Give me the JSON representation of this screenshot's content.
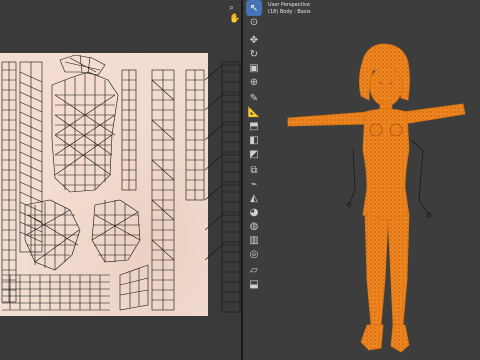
{
  "uv_editor": {
    "header_icons": [
      {
        "name": "search-icon",
        "glyph": "🔍"
      },
      {
        "name": "hand-icon",
        "glyph": "✋"
      }
    ]
  },
  "viewport": {
    "view_name": "User Perspective",
    "object_info": "(18) Body : Basis"
  },
  "toolbar": {
    "tools": [
      {
        "name": "select-tool",
        "glyph": "↖",
        "active": true
      },
      {
        "name": "cursor-tool",
        "glyph": "⊙",
        "active": false
      },
      {
        "name": "move-tool",
        "glyph": "✥",
        "active": false
      },
      {
        "name": "rotate-tool",
        "glyph": "↻",
        "active": false
      },
      {
        "name": "scale-tool",
        "glyph": "▣",
        "active": false
      },
      {
        "name": "transform-tool",
        "glyph": "⊕",
        "active": false
      },
      {
        "name": "annotate-tool",
        "glyph": "✎",
        "active": false
      },
      {
        "name": "measure-tool",
        "glyph": "📐",
        "active": false
      },
      {
        "name": "extrude-tool",
        "glyph": "⬒",
        "active": false
      },
      {
        "name": "inset-tool",
        "glyph": "◧",
        "active": false
      },
      {
        "name": "bevel-tool",
        "glyph": "◩",
        "active": false
      },
      {
        "name": "loopcut-tool",
        "glyph": "⧉",
        "active": false
      },
      {
        "name": "knife-tool",
        "glyph": "⌁",
        "active": false
      },
      {
        "name": "polybuild-tool",
        "glyph": "◭",
        "active": false
      },
      {
        "name": "spin-tool",
        "glyph": "◕",
        "active": false
      },
      {
        "name": "smooth-tool",
        "glyph": "◍",
        "active": false
      },
      {
        "name": "edge-slide-tool",
        "glyph": "▥",
        "active": false
      },
      {
        "name": "shrink-tool",
        "glyph": "◎",
        "active": false
      },
      {
        "name": "shear-tool",
        "glyph": "▱",
        "active": false
      },
      {
        "name": "rip-tool",
        "glyph": "⬓",
        "active": false
      }
    ]
  },
  "colors": {
    "accent": "#4772b3",
    "mesh_selected": "#ff9a2e",
    "viewport_bg": "#3d3d3d",
    "uv_bg": "#3a3a3a",
    "texture_base": "#f1ddd1"
  }
}
